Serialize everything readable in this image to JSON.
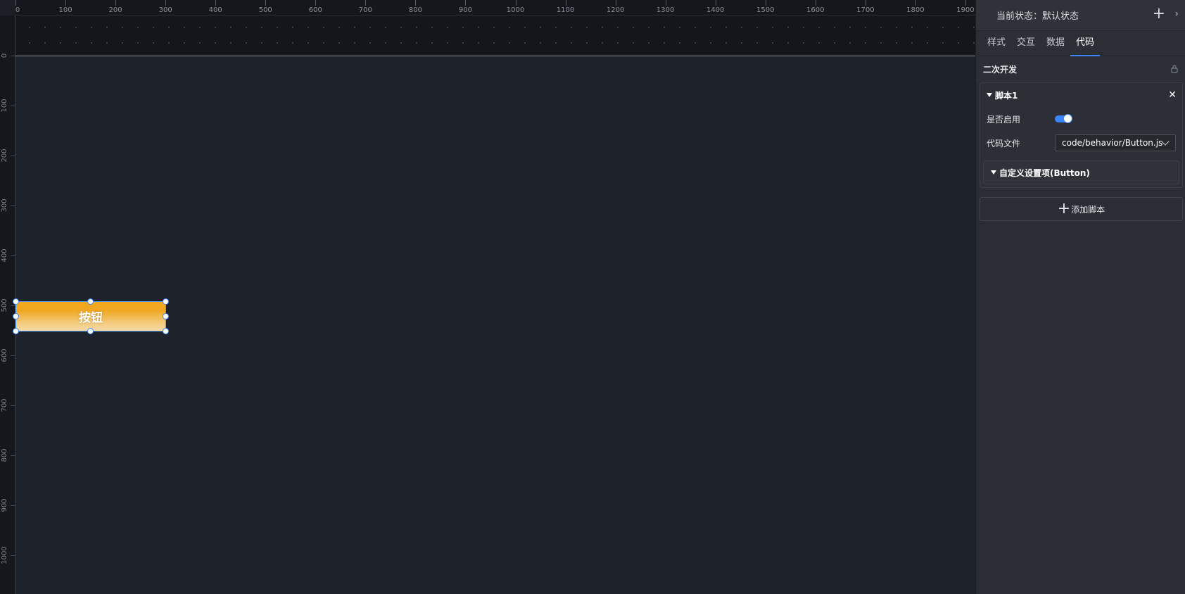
{
  "canvas": {
    "ruler_h_labels": [
      "0",
      "100",
      "200",
      "300",
      "400",
      "500",
      "600",
      "700",
      "800",
      "900",
      "1000",
      "1100",
      "1200",
      "1300",
      "1400",
      "1500",
      "1600",
      "1700",
      "1800",
      "1900"
    ],
    "ruler_v_labels": [
      "0",
      "100",
      "200",
      "300",
      "400",
      "500",
      "600",
      "700",
      "800",
      "900",
      "1000"
    ],
    "component": {
      "label": "按钮",
      "gradient_top": "#f4a81c",
      "gradient_bottom": "#f4d9a6",
      "selection_color": "#3b86ff"
    }
  },
  "panel": {
    "state_label": "当前状态：默认状态",
    "add_state_icon": "plus-icon",
    "expand_icon": "chevron-right-icon",
    "tabs": [
      {
        "label": "样式",
        "active": false
      },
      {
        "label": "交互",
        "active": false
      },
      {
        "label": "数据",
        "active": false
      },
      {
        "label": "代码",
        "active": true
      }
    ],
    "section_title": "二次开发",
    "lock_icon": "lock-icon",
    "script": {
      "title": "脚本1",
      "close_icon": "close-icon",
      "enable_label": "是否启用",
      "enabled": true,
      "file_label": "代码文件",
      "file_value": "code/behavior/Button.js",
      "custom_settings_label": "自定义设置项(Button)"
    },
    "add_script_label": "添加脚本",
    "accent_color": "#3b86ff"
  }
}
